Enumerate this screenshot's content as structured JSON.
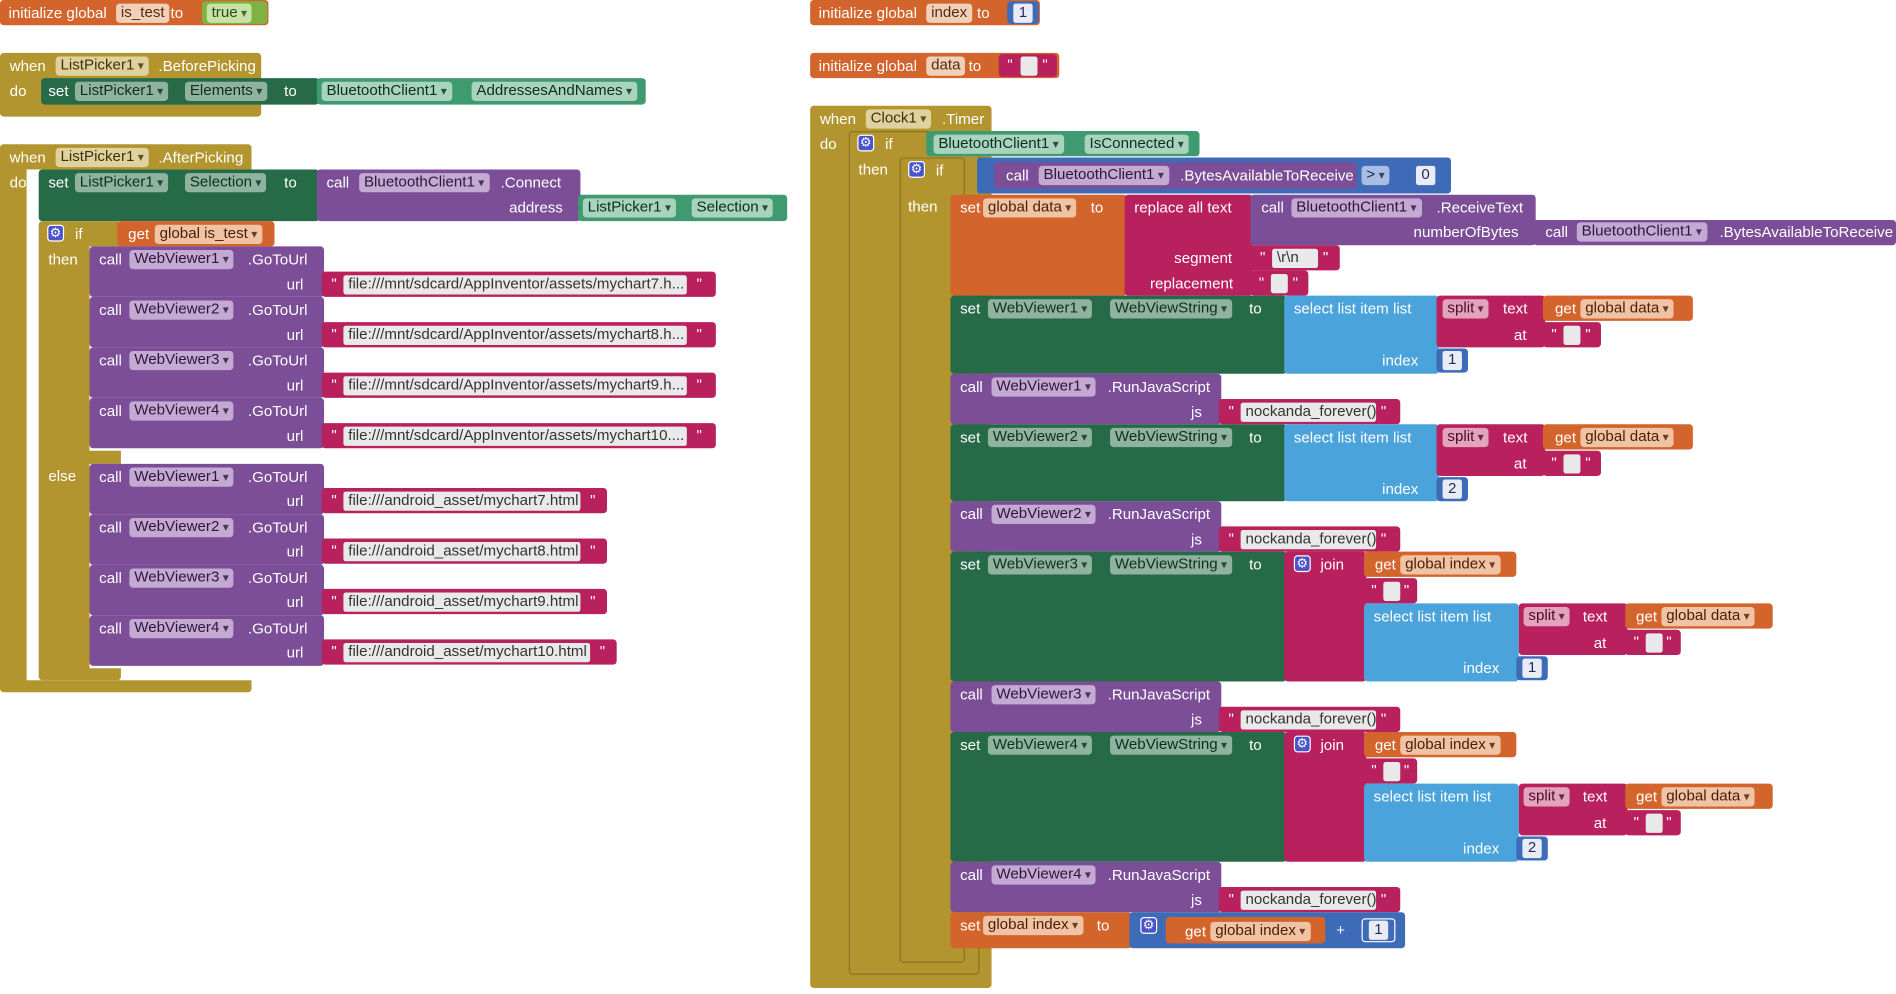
{
  "colors": {
    "control": "#b2952f",
    "variable": "#d2642c",
    "component_set": "#266a48",
    "component_call": "#7b4e97",
    "component_getter": "#3f9a6f",
    "text": "#b9205e",
    "list": "#4aa3da",
    "math": "#3d6bb8",
    "logic": "#7cb342",
    "mutator": "#4b53c8"
  },
  "icons": {
    "mutator": "gear-icon",
    "dropdown": "chevron-down-icon"
  },
  "kw": {
    "initialize_global": "initialize global",
    "to": "to",
    "when": "when",
    "do": "do",
    "set": "set",
    "call": "call",
    "if": "if",
    "then": "then",
    "else": "else",
    "get": "get",
    "url": "url",
    "address": "address",
    "js": "js",
    "join": "join",
    "select_list_item": "select list item  list",
    "index": "index",
    "split": "split",
    "text": "text",
    "at": "at",
    "replace_all_text": "replace all text",
    "segment": "segment",
    "replacement": "replacement",
    "number_of_bytes": "numberOfBytes",
    "plus": "+",
    "gt": ">"
  },
  "vars": {
    "is_test": "is_test",
    "index": "index",
    "data": "data",
    "global_is_test": "global is_test",
    "global_data": "global data",
    "global_index": "global index"
  },
  "values": {
    "true": "true",
    "one": "1",
    "two": "2",
    "zero": "0",
    "newline": "\\r\\n",
    "js_call": "nockanda_forever()"
  },
  "components": {
    "listpicker1": "ListPicker1",
    "bluetooth": "BluetoothClient1",
    "clock1": "Clock1",
    "webviewer1": "WebViewer1",
    "webviewer2": "WebViewer2",
    "webviewer3": "WebViewer3",
    "webviewer4": "WebViewer4"
  },
  "members": {
    "before_picking": ".BeforePicking",
    "after_picking": ".AfterPicking",
    "timer": ".Timer",
    "elements": "Elements",
    "addresses_and_names": "AddressesAndNames",
    "selection": "Selection",
    "connect": ".Connect",
    "go_to_url": ".GoToUrl",
    "is_connected": "IsConnected",
    "bytes_available": ".BytesAvailableToReceive",
    "receive_text": ".ReceiveText",
    "web_view_string": "WebViewString",
    "run_js": ".RunJavaScript"
  },
  "urls": {
    "sd7": "file:///mnt/sdcard/AppInventor/assets/mychart7.h...",
    "sd8": "file:///mnt/sdcard/AppInventor/assets/mychart8.h...",
    "sd9": "file:///mnt/sdcard/AppInventor/assets/mychart9.h...",
    "sd10": "file:///mnt/sdcard/AppInventor/assets/mychart10....",
    "a7": "file:///android_asset/mychart7.html",
    "a8": "file:///android_asset/mychart8.html",
    "a9": "file:///android_asset/mychart9.html",
    "a10": "file:///android_asset/mychart10.html"
  }
}
